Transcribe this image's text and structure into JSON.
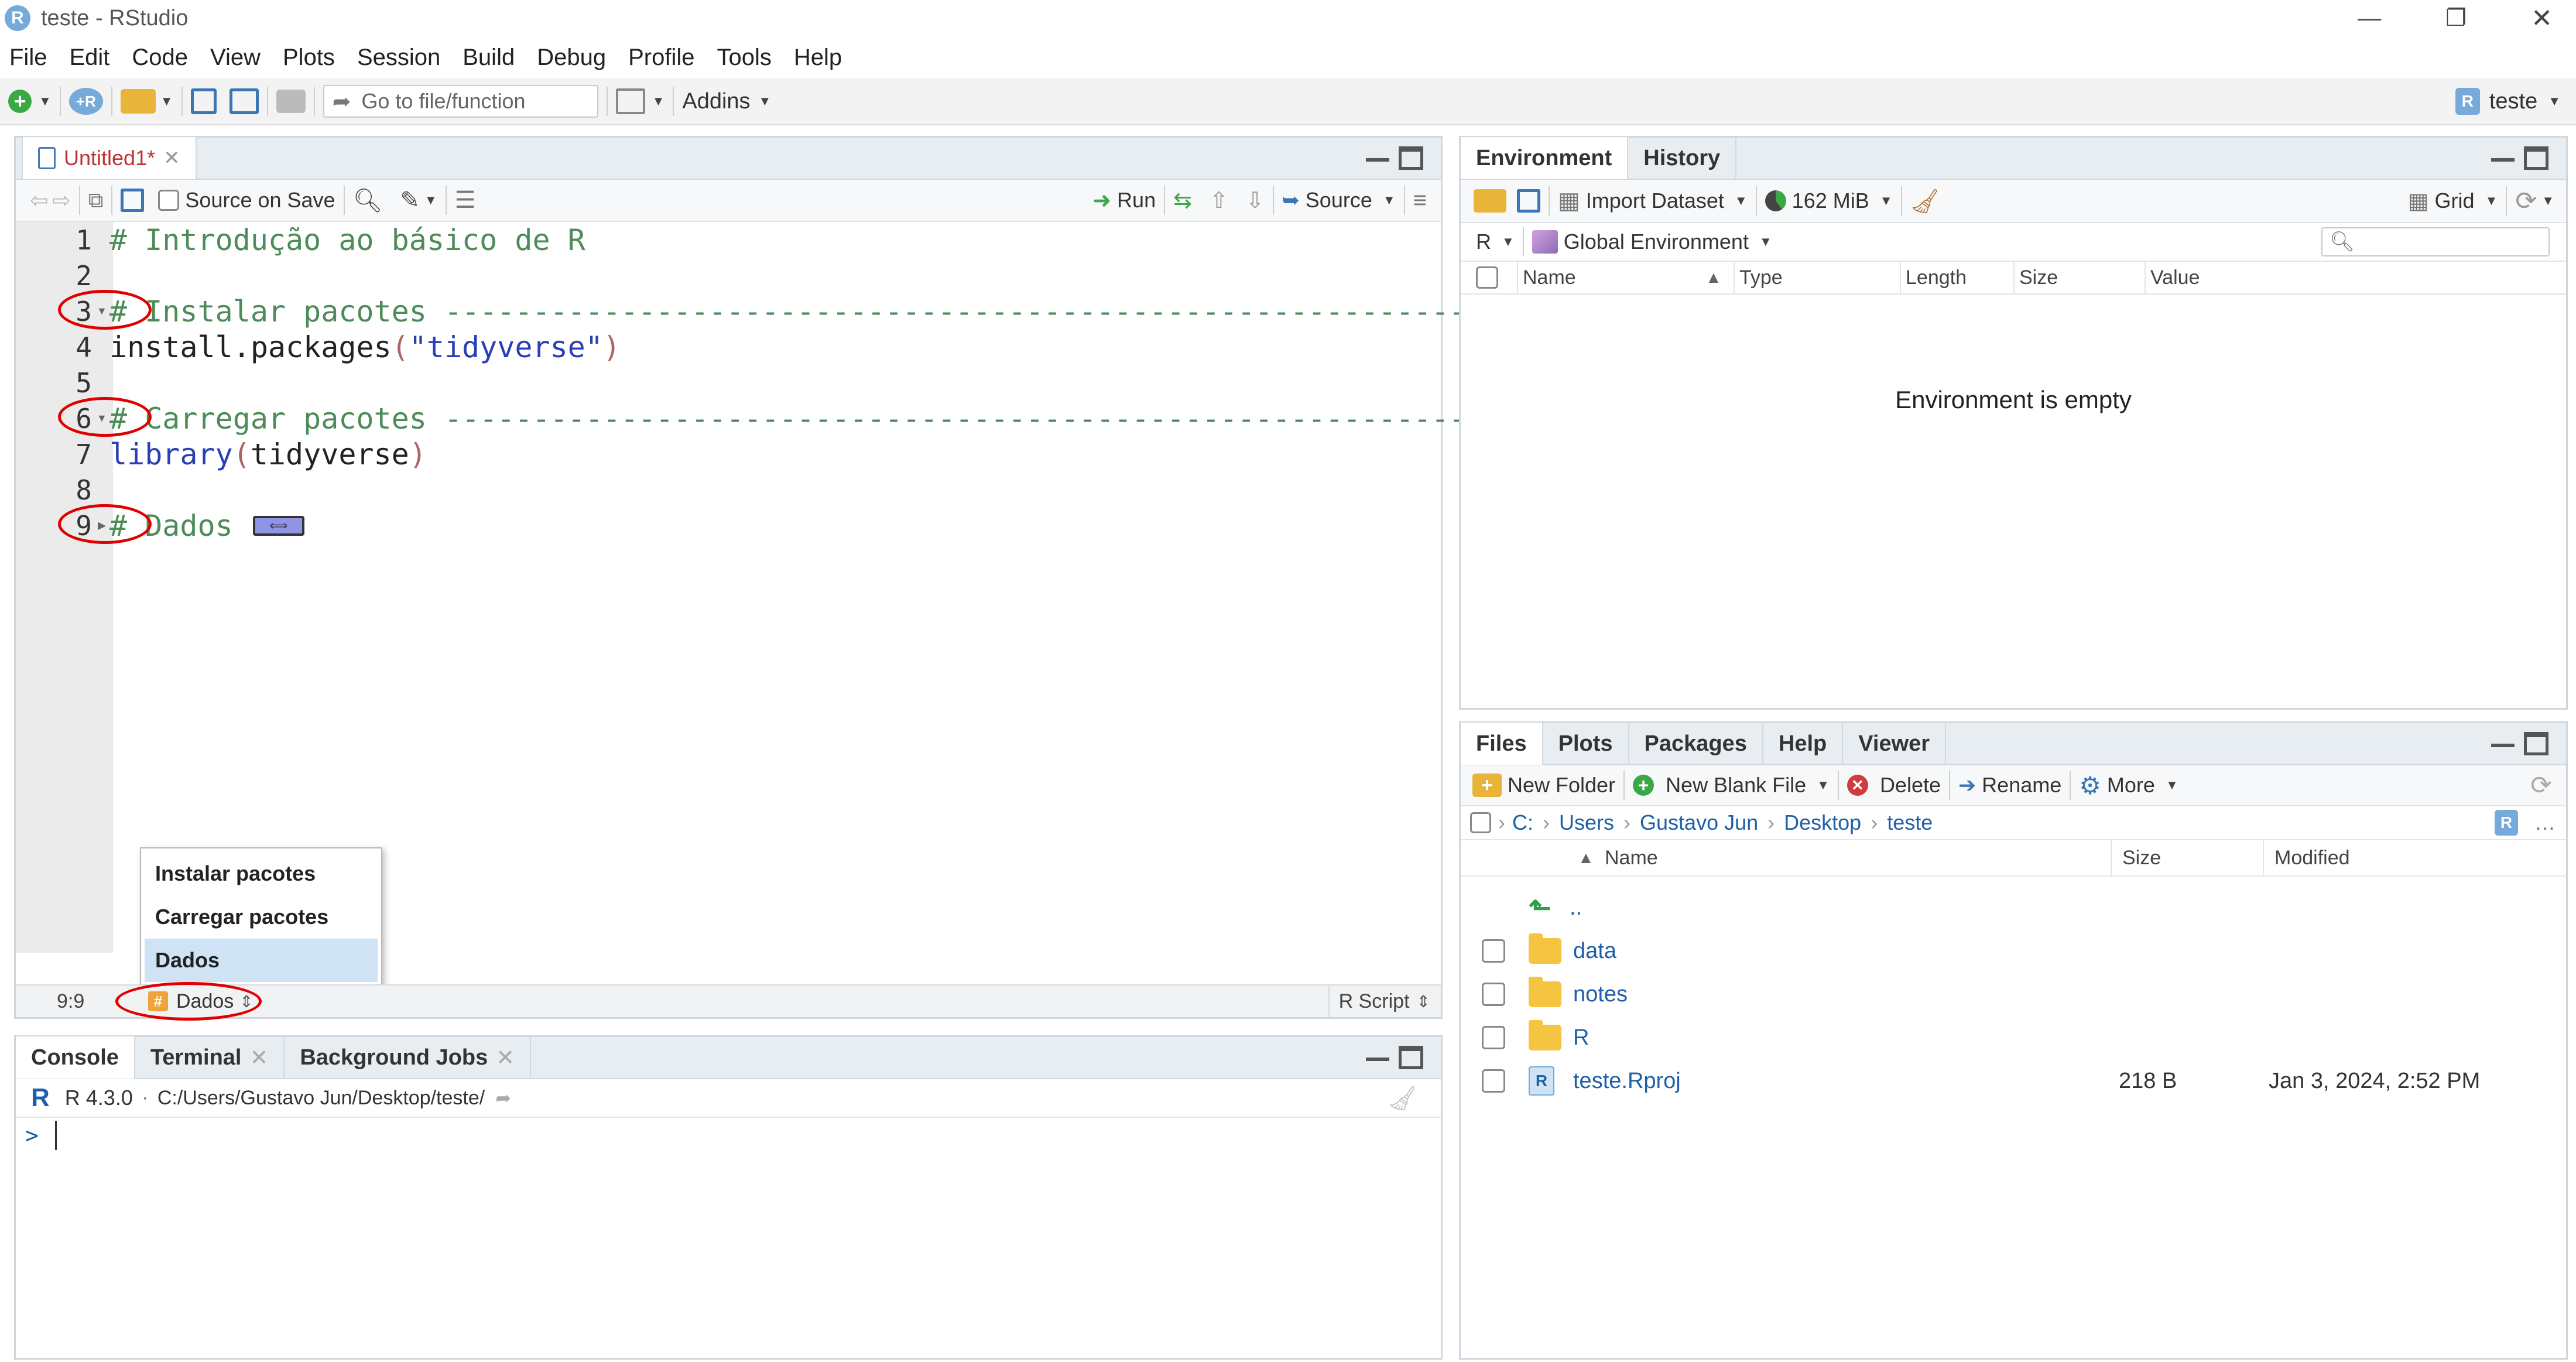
{
  "window": {
    "title": "teste - RStudio"
  },
  "menu": [
    "File",
    "Edit",
    "Code",
    "View",
    "Plots",
    "Session",
    "Build",
    "Debug",
    "Profile",
    "Tools",
    "Help"
  ],
  "toolbar": {
    "goto_placeholder": "Go to file/function",
    "addins": "Addins",
    "project": "teste"
  },
  "editor": {
    "tab": "Untitled1*",
    "source_on_save": "Source on Save",
    "run": "Run",
    "source": "Source",
    "lines": [
      {
        "n": "1",
        "text": "# Introdução ao básico de R",
        "kind": "comment"
      },
      {
        "n": "2",
        "text": "",
        "kind": "plain"
      },
      {
        "n": "3",
        "text": "# Instalar pacotes -----------------------------------------------------------",
        "kind": "comment"
      },
      {
        "n": "4",
        "text": "install.packages(\"tidyverse\")",
        "kind": "code1"
      },
      {
        "n": "5",
        "text": "",
        "kind": "plain"
      },
      {
        "n": "6",
        "text": "# Carregar pacotes -----------------------------------------------------------",
        "kind": "comment"
      },
      {
        "n": "7",
        "text": "library(tidyverse)",
        "kind": "code2"
      },
      {
        "n": "8",
        "text": "",
        "kind": "plain"
      },
      {
        "n": "9",
        "text": "# Dados ",
        "kind": "comment"
      }
    ],
    "section_menu": [
      "Instalar pacotes",
      "Carregar pacotes",
      "Dados"
    ],
    "status": {
      "position": "9:9",
      "section": "Dados",
      "type": "R Script"
    }
  },
  "console": {
    "tabs": [
      "Console",
      "Terminal",
      "Background Jobs"
    ],
    "version": "R 4.3.0",
    "path": "C:/Users/Gustavo Jun/Desktop/teste/",
    "prompt": ">"
  },
  "environment": {
    "tabs": [
      "Environment",
      "History"
    ],
    "import_dataset": "Import Dataset",
    "memory": "162 MiB",
    "view_mode": "Grid",
    "language": "R",
    "scope": "Global Environment",
    "columns": [
      "Name",
      "Type",
      "Length",
      "Size",
      "Value"
    ],
    "empty_message": "Environment is empty"
  },
  "files": {
    "tabs": [
      "Files",
      "Plots",
      "Packages",
      "Help",
      "Viewer"
    ],
    "new_folder": "New Folder",
    "new_blank_file": "New Blank File",
    "delete": "Delete",
    "rename": "Rename",
    "more": "More",
    "breadcrumb": [
      "C:",
      "Users",
      "Gustavo Jun",
      "Desktop",
      "teste"
    ],
    "columns": [
      "Name",
      "Size",
      "Modified"
    ],
    "up": "..",
    "rows": [
      {
        "name": "data",
        "size": "",
        "modified": ""
      },
      {
        "name": "notes",
        "size": "",
        "modified": ""
      },
      {
        "name": "R",
        "size": "",
        "modified": ""
      },
      {
        "name": "teste.Rproj",
        "size": "218 B",
        "modified": "Jan 3, 2024, 2:52 PM"
      }
    ]
  }
}
